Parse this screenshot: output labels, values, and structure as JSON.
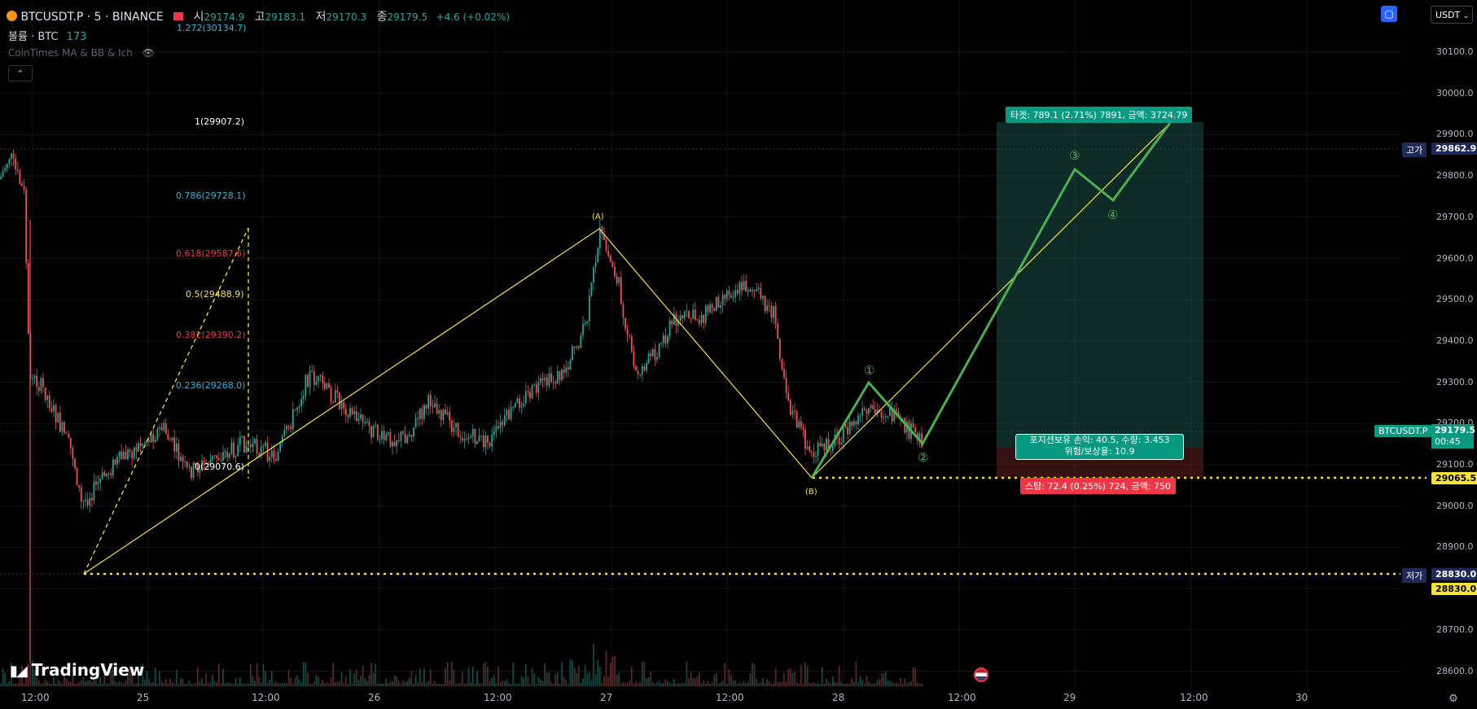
{
  "header": {
    "symbol": "BTCUSDT.P · 5 · BINANCE",
    "open_label": "시",
    "open": "29174.9",
    "high_label": "고",
    "high": "29183.1",
    "low_label": "저",
    "low": "29170.3",
    "close_label": "종",
    "close": "29179.5",
    "change": "+4.6 (+0.02%)",
    "volume_label": "볼륨 · BTC",
    "volume": "173",
    "indicator": "CoinTimes MA & BB & Ich",
    "currency": "USDT"
  },
  "watermark": "TradingView",
  "price_axis": {
    "ticks": [
      "30100.0",
      "30000.0",
      "29900.0",
      "29800.0",
      "29700.0",
      "29600.0",
      "29500.0",
      "29400.0",
      "29300.0",
      "29200.0",
      "29100.0",
      "29000.0",
      "28900.0",
      "28800.0",
      "28700.0",
      "28600.0"
    ]
  },
  "time_axis": {
    "labels": [
      "12:00",
      "25",
      "12:00",
      "26",
      "12:00",
      "27",
      "12:00",
      "28",
      "12:00",
      "29",
      "12:00",
      "30"
    ]
  },
  "price_tags": {
    "high_label": "고가",
    "high_value": "29862.9",
    "symbol_tag": "BTCUSDT.P",
    "last_value": "29179.5",
    "countdown": "00:45",
    "stop_value": "29065.5",
    "low_label": "저가",
    "low_value": "28830.0",
    "low_value2": "28830.0"
  },
  "fib": {
    "levels": [
      {
        "label": "1.272(30134.7)",
        "color": "#2fb8d8"
      },
      {
        "label": "1(29907.2)",
        "color": "#ffffff"
      },
      {
        "label": "0.786(29728.1)",
        "color": "#2fb8d8"
      },
      {
        "label": "0.618(29587.6)",
        "color": "#f23645"
      },
      {
        "label": "0.5(29488.9)",
        "color": "#f5e53a"
      },
      {
        "label": "0.382(29390.2)",
        "color": "#f23645"
      },
      {
        "label": "0.236(29268.0)",
        "color": "#2fb8d8"
      },
      {
        "label": "0(29070.6)",
        "color": "#ffffff"
      }
    ]
  },
  "wave_labels": {
    "a": "(A)",
    "b": "(B)",
    "w1": "①",
    "w2": "②",
    "w3": "③",
    "w4": "④"
  },
  "position": {
    "target_label": "타겟: 789.1 (2.71%) 7891, 금액: 3724.79",
    "info_line1": "포지션보유 손익: 40.5, 수량: 3.453",
    "info_line2": "위험/보상율: 10.9",
    "stop_label": "스탑: 72.4 (0.25%) 724, 금액: 750"
  },
  "colors": {
    "up": "#26a69a",
    "down": "#ef5350",
    "wave": "#4caf50",
    "abc_line": "#f5e53a",
    "tag_blue": "#1e2a5a",
    "accent": "#2962ff"
  }
}
